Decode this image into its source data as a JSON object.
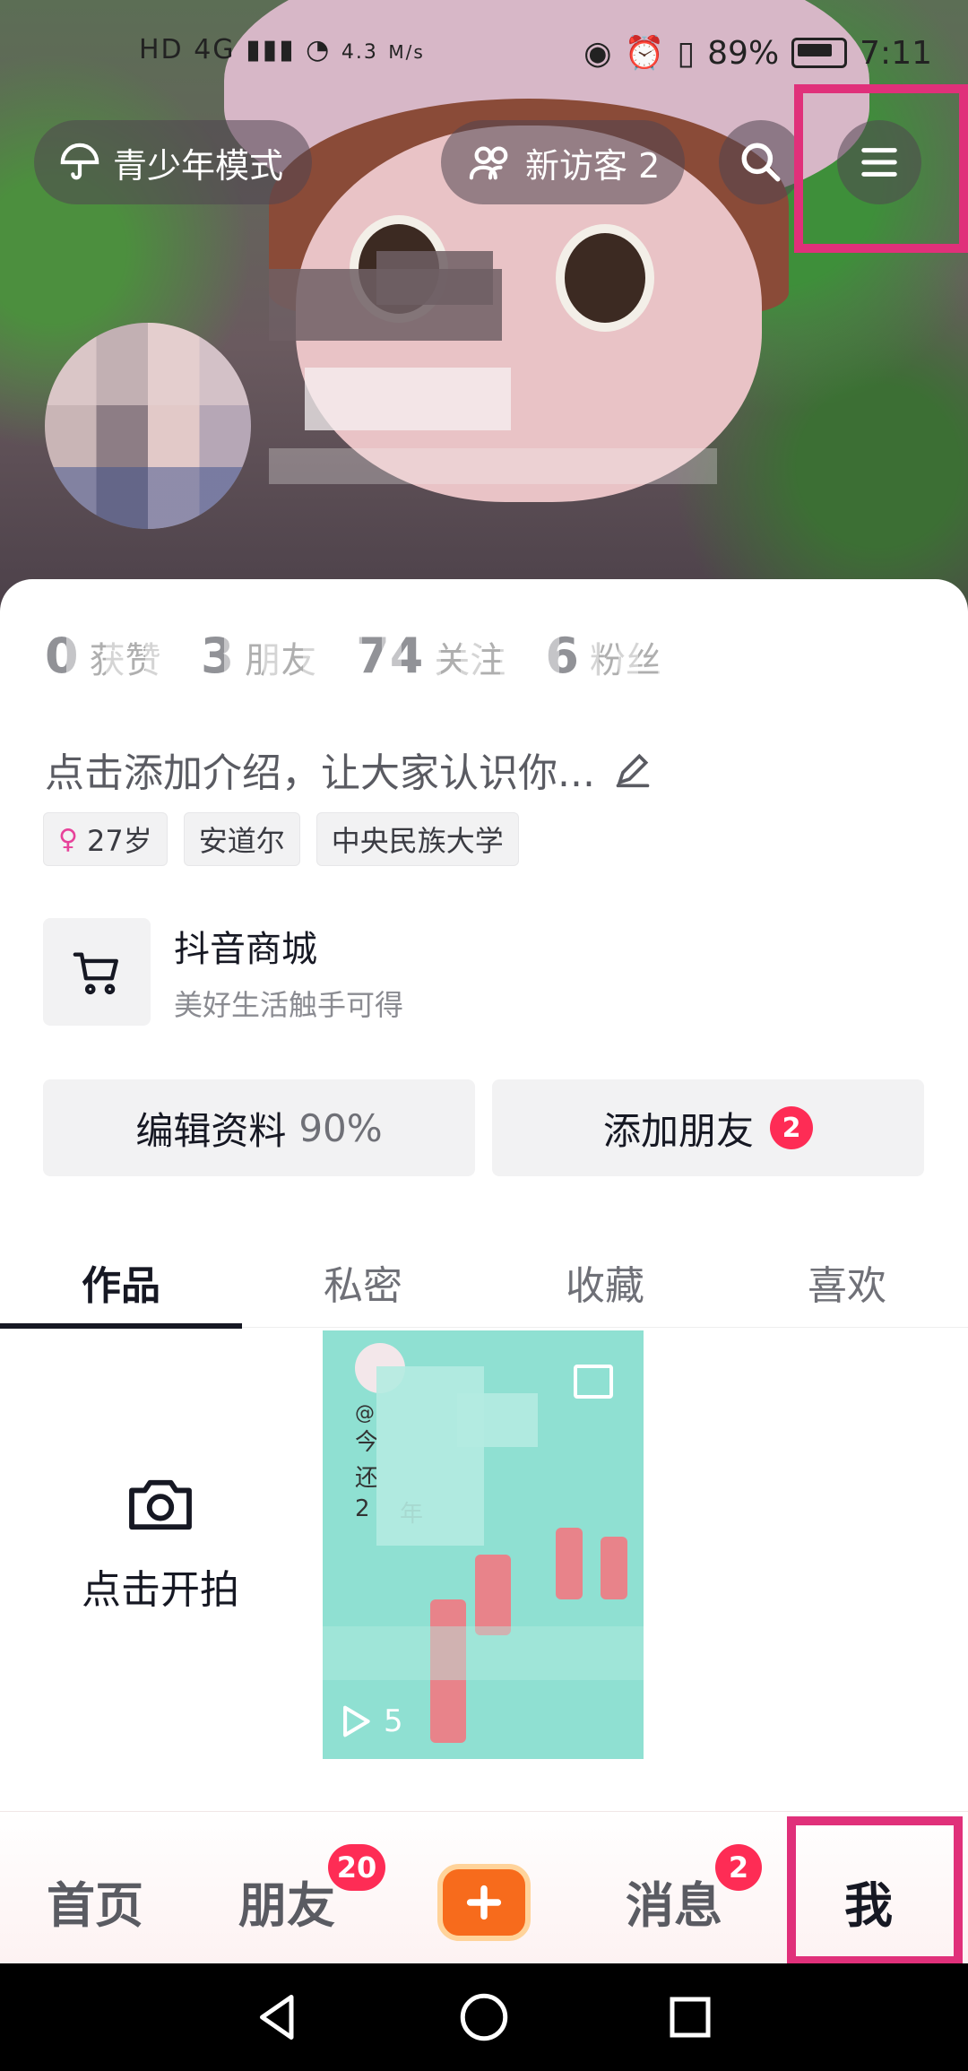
{
  "status_bar": {
    "network": "HD 4G",
    "speed": "4.3",
    "speed_unit": "M/s",
    "battery": "89%",
    "time": "7:11"
  },
  "header": {
    "youth_mode_label": "青少年模式",
    "new_visitors_label": "新访客 2",
    "search_icon": "search-icon",
    "menu_icon": "menu-icon"
  },
  "stats": [
    {
      "num": "0",
      "label": "获赞"
    },
    {
      "num": "3",
      "label": "朋友"
    },
    {
      "num": "74",
      "label": "关注"
    },
    {
      "num": "6",
      "label": "粉丝"
    }
  ],
  "bio": {
    "text": "点击添加介绍，让大家认识你...",
    "edit_icon": "pencil-icon"
  },
  "tags": {
    "age": "27岁",
    "location": "安道尔",
    "school": "中央民族大学"
  },
  "mall": {
    "title": "抖音商城",
    "subtitle": "美好生活触手可得",
    "icon": "cart-icon"
  },
  "actions": {
    "edit_label": "编辑资料",
    "edit_percent": "90%",
    "add_friend_label": "添加朋友",
    "add_friend_badge": "2"
  },
  "tabs": [
    {
      "label": "作品",
      "active": true
    },
    {
      "label": "私密",
      "active": false
    },
    {
      "label": "收藏",
      "active": false
    },
    {
      "label": "喜欢",
      "active": false
    }
  ],
  "works": {
    "shoot_label": "点击开拍",
    "thumb_play_count": "5",
    "thumb_lines": [
      "@",
      "今",
      "还",
      "2",
      "年"
    ]
  },
  "bottom_nav": {
    "home": "首页",
    "friends": "朋友",
    "friends_badge": "20",
    "messages": "消息",
    "messages_badge": "2",
    "me": "我"
  },
  "colors": {
    "accent": "#fe2c55",
    "highlight": "#e0307a",
    "plus_button": "#f76b1c"
  }
}
